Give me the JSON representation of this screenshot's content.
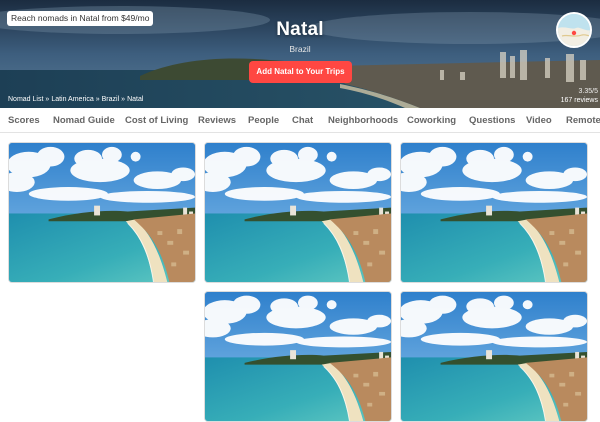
{
  "hero": {
    "promo_text": "Reach nomads in Natal from $49/mo",
    "city": "Natal",
    "country": "Brazil",
    "add_trip_label": "Add Natal to Your Trips",
    "breadcrumb": [
      "Nomad List",
      "Latin America",
      "Brazil",
      "Natal"
    ],
    "breadcrumb_separator": "»",
    "rating": "3.35/5",
    "reviews": "167 reviews"
  },
  "tabs": [
    {
      "label": "Scores"
    },
    {
      "label": "Nomad Guide"
    },
    {
      "label": "Cost of Living"
    },
    {
      "label": "Reviews"
    },
    {
      "label": "People"
    },
    {
      "label": "Chat"
    },
    {
      "label": "Neighborhoods"
    },
    {
      "label": "Coworking"
    },
    {
      "label": "Questions"
    },
    {
      "label": "Video"
    },
    {
      "label": "Remote"
    }
  ],
  "photos": [
    {
      "subject": "aerial beach view"
    },
    {
      "subject": "aerial beach view"
    },
    {
      "subject": "aerial beach view"
    },
    {
      "subject": "aerial beach view"
    },
    {
      "subject": "aerial beach view"
    }
  ],
  "colors": {
    "accent_button": "#ff4742",
    "tab_text": "#666666",
    "sky": "#3f95d8",
    "sea": "#2fa4b8"
  }
}
